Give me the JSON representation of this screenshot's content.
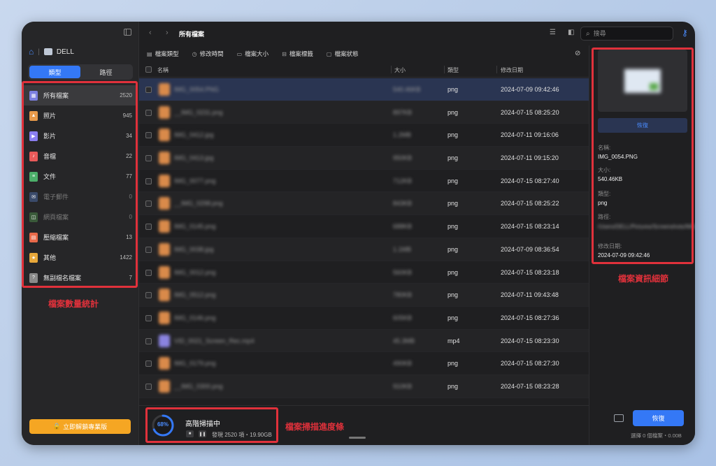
{
  "device": {
    "name": "DELL"
  },
  "tabs": [
    {
      "label": "類型"
    },
    {
      "label": "路徑"
    }
  ],
  "categories": [
    {
      "label": "所有檔案",
      "count": "2520",
      "color": "#7b7fe0",
      "icon": "grid-icon"
    },
    {
      "label": "照片",
      "count": "945",
      "color": "#e89a4a",
      "icon": "photo-icon"
    },
    {
      "label": "影片",
      "count": "34",
      "color": "#8a7ef0",
      "icon": "video-icon"
    },
    {
      "label": "音檔",
      "count": "22",
      "color": "#e85a5a",
      "icon": "audio-icon"
    },
    {
      "label": "文件",
      "count": "77",
      "color": "#4caf6a",
      "icon": "document-icon"
    },
    {
      "label": "電子郵件",
      "count": "0",
      "color": "#3a4a6a",
      "icon": "email-icon"
    },
    {
      "label": "網頁檔案",
      "count": "0",
      "color": "#3a5a3a",
      "icon": "webpage-icon"
    },
    {
      "label": "壓縮檔案",
      "count": "13",
      "color": "#e86a4a",
      "icon": "archive-icon"
    },
    {
      "label": "其他",
      "count": "1422",
      "color": "#e8a83a",
      "icon": "star-icon"
    },
    {
      "label": "無副檔名檔案",
      "count": "7",
      "color": "#8a8a8a",
      "icon": "unknown-file-icon"
    }
  ],
  "unlock_button": "立即解鎖專業版",
  "breadcrumb": "所有檔案",
  "search": {
    "placeholder": "搜尋"
  },
  "filters": [
    {
      "label": "檔案類型"
    },
    {
      "label": "修改時間"
    },
    {
      "label": "檔案大小"
    },
    {
      "label": "檔案標籤"
    },
    {
      "label": "檔案狀態"
    }
  ],
  "table": {
    "headers": {
      "name": "名稱",
      "size": "大小",
      "type": "類型",
      "date": "修改日期"
    },
    "rows": [
      {
        "name": "IMG_0054.PNG",
        "size": "540.46KB",
        "type": "png",
        "date": "2024-07-09 09:42:46"
      },
      {
        "name": "__IMG_0231.png",
        "size": "897KB",
        "type": "png",
        "date": "2024-07-15 08:25:20"
      },
      {
        "name": "IMG_0412.jpg",
        "size": "1.2MB",
        "type": "png",
        "date": "2024-07-11 09:16:06"
      },
      {
        "name": "IMG_0413.jpg",
        "size": "950KB",
        "type": "png",
        "date": "2024-07-11 09:15:20"
      },
      {
        "name": "IMG_0077.png",
        "size": "712KB",
        "type": "png",
        "date": "2024-07-15 08:27:40"
      },
      {
        "name": "__IMG_0298.png",
        "size": "843KB",
        "type": "png",
        "date": "2024-07-15 08:25:22"
      },
      {
        "name": "IMG_0145.png",
        "size": "688KB",
        "type": "png",
        "date": "2024-07-15 08:23:14"
      },
      {
        "name": "IMG_0038.jpg",
        "size": "1.1MB",
        "type": "png",
        "date": "2024-07-09 08:36:54"
      },
      {
        "name": "IMG_0012.png",
        "size": "560KB",
        "type": "png",
        "date": "2024-07-15 08:23:18"
      },
      {
        "name": "IMG_0512.png",
        "size": "780KB",
        "type": "png",
        "date": "2024-07-11 09:43:48"
      },
      {
        "name": "IMG_0146.png",
        "size": "605KB",
        "type": "png",
        "date": "2024-07-15 08:27:36"
      },
      {
        "name": "VID_0021_Screen_Rec.mp4",
        "size": "45.3MB",
        "type": "mp4",
        "date": "2024-07-15 08:23:30"
      },
      {
        "name": "IMG_0179.png",
        "size": "490KB",
        "type": "png",
        "date": "2024-07-15 08:27:30"
      },
      {
        "name": "__IMG_0300.png",
        "size": "910KB",
        "type": "png",
        "date": "2024-07-15 08:23:28"
      }
    ]
  },
  "scan": {
    "progress_pct": 68,
    "progress_label": "68%",
    "title": "高階掃描中",
    "status": "發現 2520 項・19.90GB"
  },
  "details": {
    "restore_label": "恢復",
    "name_label": "名稱:",
    "name": "IMG_0054.PNG",
    "size_label": "大小:",
    "size": "540.46KB",
    "type_label": "類型:",
    "type": "png",
    "path_label": "路徑:",
    "path": "/Users/DELL/Pictures/Screenshots/IMG_0054.PNG",
    "date_label": "修改日期:",
    "date": "2024-07-09 09:42:46"
  },
  "restore_button": "恢復",
  "selection_info": "選擇 0 個檔案・0.00B",
  "annotations": {
    "categories": "檔案數量統計",
    "progress": "檔案掃描進度條",
    "details": "檔案資訊細節"
  }
}
